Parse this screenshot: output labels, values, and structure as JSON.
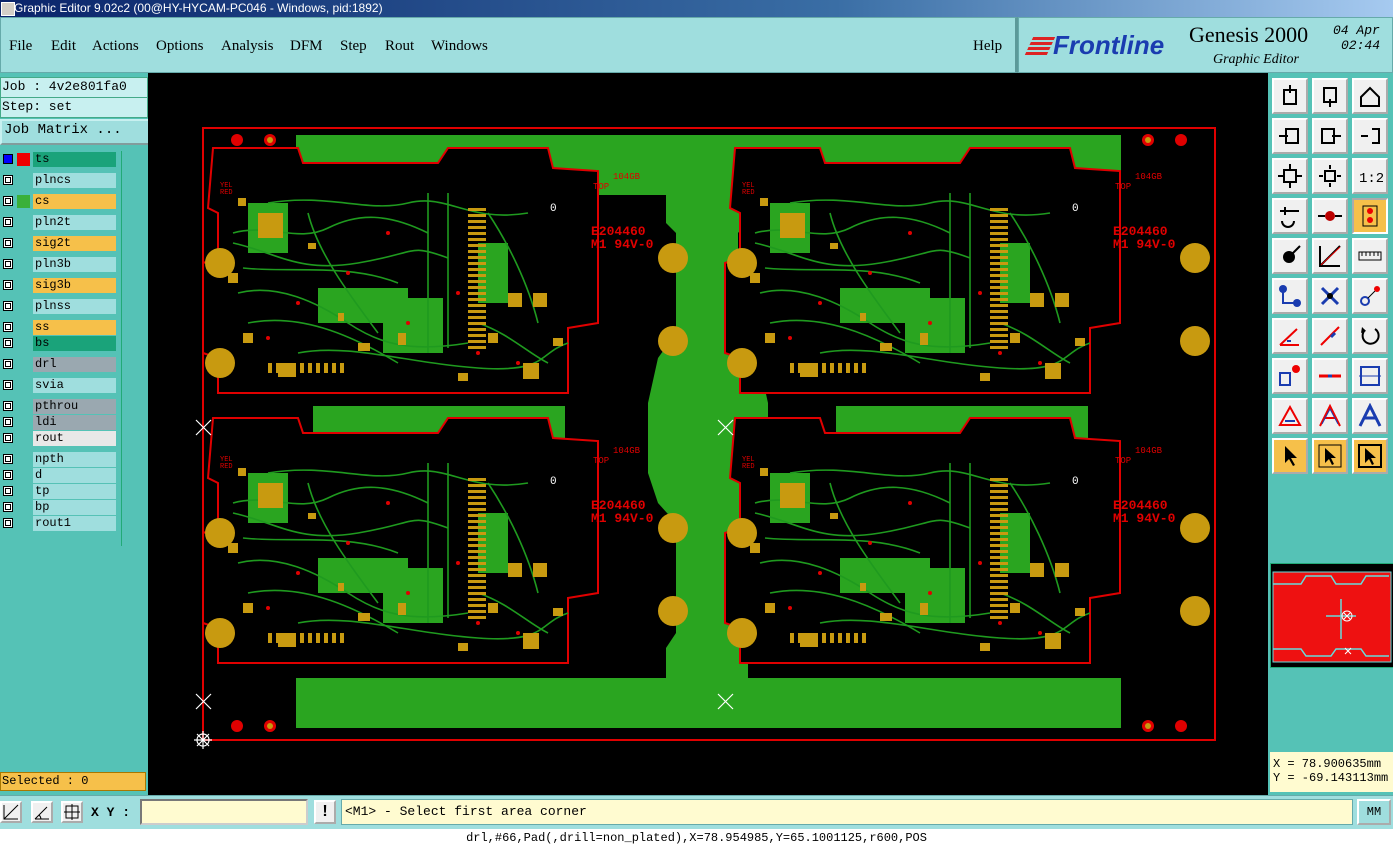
{
  "window": {
    "title": "Graphic Editor 9.02c2 (00@HY-HYCAM-PC046 - Windows, pid:1892)"
  },
  "menu": [
    "File",
    "Edit",
    "Actions",
    "Options",
    "Analysis",
    "DFM",
    "Step",
    "Rout",
    "Windows"
  ],
  "help_label": "Help",
  "brand": {
    "logo": "Frontline",
    "product": "Genesis 2000",
    "subtitle": "Graphic Editor",
    "date": "04 Apr",
    "time": "02:44"
  },
  "job": {
    "job_label": "Job : 4v2e801fa0",
    "step_label": "Step: set",
    "job_matrix_label": "Job Matrix ..."
  },
  "layers": [
    {
      "name": "ts",
      "color": "#1aa37a"
    },
    {
      "name": "plncs",
      "color": "#9fdede"
    },
    {
      "name": "cs",
      "color": "#f6c04a"
    },
    {
      "name": "pln2t",
      "color": "#9fdede"
    },
    {
      "name": "sig2t",
      "color": "#f6c04a"
    },
    {
      "name": "pln3b",
      "color": "#9fdede"
    },
    {
      "name": "sig3b",
      "color": "#f6c04a"
    },
    {
      "name": "plnss",
      "color": "#9fdede"
    },
    {
      "name": "ss",
      "color": "#f6c04a"
    },
    {
      "name": "bs",
      "color": "#1aa37a"
    },
    {
      "name": "drl",
      "color": "#9aa8b0"
    },
    {
      "name": "svia",
      "color": "#9fdede"
    },
    {
      "name": "pthrou",
      "color": "#9aa8b0"
    },
    {
      "name": "ldi",
      "color": "#9aa8b0"
    },
    {
      "name": "rout",
      "color": "#e8e8e8"
    },
    {
      "name": "npth",
      "color": "#9fdede"
    },
    {
      "name": "d",
      "color": "#9fdede"
    },
    {
      "name": "tp",
      "color": "#9fdede"
    },
    {
      "name": "bp",
      "color": "#9fdede"
    },
    {
      "name": "rout1",
      "color": "#9fdede"
    }
  ],
  "selected_label": "Selected : 0",
  "coordinates": {
    "x": "X = 78.900635mm",
    "y": "Y = -69.143113mm"
  },
  "bottom": {
    "xy_label": "X Y :",
    "xy_value": "",
    "prompt": "<M1> - Select first area corner",
    "units_button": "MM"
  },
  "status_line": "drl,#66,Pad(,drill=non_plated),X=78.954985,Y=65.1001125,r600,POS",
  "board": {
    "silk_codes": [
      "E204460",
      "M1 94V-0"
    ],
    "silk_small": [
      "104GB",
      "TOP",
      "YEL",
      "RED"
    ],
    "zero_marker": "0"
  },
  "colors": {
    "trace": "#1f9a1f",
    "copper": "#2aa520",
    "pad": "#c89a10",
    "outline": "#e00000",
    "accent": "#9fdede"
  }
}
